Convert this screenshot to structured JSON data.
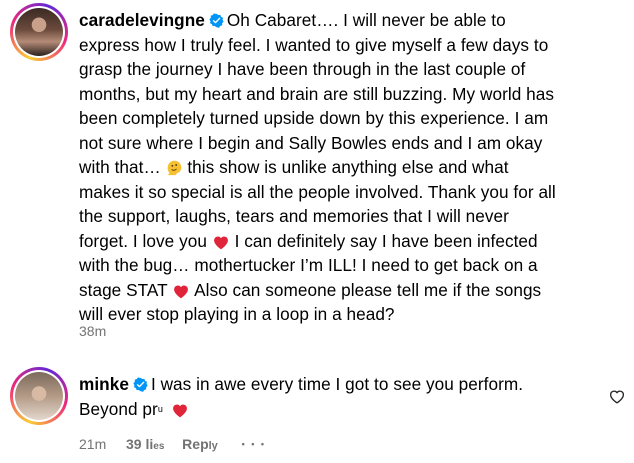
{
  "comments": [
    {
      "username": "caradelevingne",
      "verified": true,
      "lines": [
        "Oh Cabaret…. I will never be able to",
        "express how I truly feel. I wanted to give myself a few days to",
        "grasp the journey I have been through in the last couple of",
        "months, but my heart and brain are still buzzing. My world has",
        "been completely turned upside down by this experience. I am",
        "not sure where I begin and Sally Bowles ends and I am okay",
        "with that… ",
        " this show is unlike anything else and what",
        "makes it so special is all the people involved. Thank you for all",
        "the support, laughs, tears and memories that I will never",
        "forget. I love you ",
        " I can definitely say I have been infected",
        "with the bug… mothertucker I’m ILL! I need to get back on a",
        "stage STAT ",
        " Also can someone please tell me if the songs",
        "will ever stop playing in a loop in a head?"
      ],
      "time": "38m"
    },
    {
      "username": "minke",
      "verified": true,
      "lines": [
        "I was in awe every time I got to see you perform.",
        "Beyond pr",
        "u"
      ],
      "time": "21m",
      "likes": "39 li",
      "likes_rest": "es",
      "reply": "Rep",
      "reply_rest": "ly",
      "more": "• • •"
    }
  ],
  "icons": {
    "heart_emoji": "red-heart-icon",
    "melting_face": "melting-face-icon",
    "like": "heart-outline-icon",
    "verified": "verified-badge-icon"
  },
  "colors": {
    "verified": "#0095f6",
    "heart": "#e0243a",
    "meta": "#737373"
  }
}
